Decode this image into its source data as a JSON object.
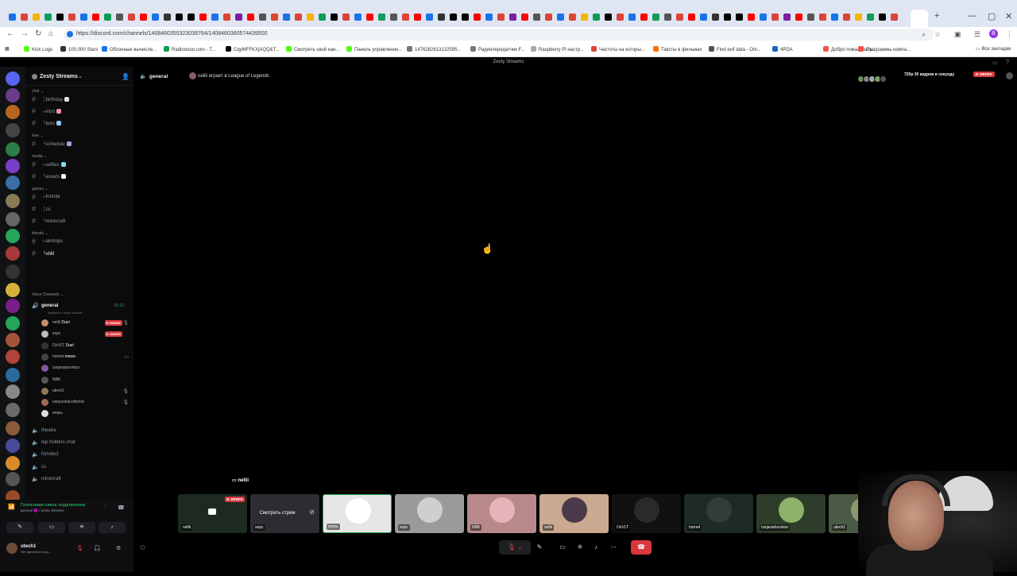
{
  "browser": {
    "url": "https://discord.com/channels/1408460355323039764/1408460360574439500",
    "bookmarks": [
      {
        "label": "Kick Logo",
        "color": "#53fc18"
      },
      {
        "label": "100,000 Stars",
        "color": "#333333"
      },
      {
        "label": "Облачные вычисле...",
        "color": "#1a73e8"
      },
      {
        "label": "Radiooooo.com - T...",
        "color": "#0f9d58"
      },
      {
        "label": "CqyMFFKXjAQQ&T...",
        "color": "#000000"
      },
      {
        "label": "Смотреть свой кан...",
        "color": "#53fc18"
      },
      {
        "label": "Панель управления...",
        "color": "#53fc18"
      },
      {
        "label": "1476282613122595...",
        "color": "#777777"
      },
      {
        "label": "Радиопередатчик F...",
        "color": "#777777"
      },
      {
        "label": "Raspberry Pi настр...",
        "color": "#aaaaaa"
      },
      {
        "label": "Частоты на которы...",
        "color": "#db4437"
      },
      {
        "label": "Таксты в фильмах",
        "color": "#ff6d00"
      },
      {
        "label": "Find exif data - Onl...",
        "color": "#555555"
      },
      {
        "label": "4PDA",
        "color": "#1565c0"
      },
      {
        "label": "Добро пожаловать...",
        "color": "#ef5350"
      },
      {
        "label": "Программы компа...",
        "color": "#ef5350"
      }
    ],
    "all_bookmarks": "Все закладки",
    "profile_initial": "B"
  },
  "app": {
    "window_title": "Zesty Streams"
  },
  "sidebar": {
    "server_name": "Zesty Streams",
    "categories": [
      {
        "name": "chat",
        "channels": [
          {
            "name": "╎birthday",
            "emoji": "#e0e0e0"
          },
          {
            "name": "⌐intro",
            "emoji": "#f48fb1"
          },
          {
            "name": "╰bots",
            "emoji": "#90caf9"
          }
        ]
      },
      {
        "name": "love",
        "channels": [
          {
            "name": "╰schedule",
            "emoji": "#b39ddb"
          }
        ]
      },
      {
        "name": "media",
        "channels": [
          {
            "name": "⌐selfies",
            "emoji": "#80deea"
          },
          {
            "name": "╰assets",
            "emoji": "#ffffff"
          }
        ]
      },
      {
        "name": "games",
        "channels": [
          {
            "name": "⌐fortnite",
            "emoji": ""
          },
          {
            "name": "╎cs",
            "emoji": ""
          },
          {
            "name": "╰minecraft",
            "emoji": ""
          }
        ]
      },
      {
        "name": "friends",
        "channels": [
          {
            "name": "⌐airdrops",
            "emoji": ""
          },
          {
            "name": "╰shill",
            "emoji": ""
          }
        ]
      }
    ],
    "voice_category": "Voice Channels",
    "active_voice": {
      "name": "general",
      "timer": "51:22",
      "status": "Выбрать статус канала"
    },
    "voice_users": [
      {
        "name": "nellii",
        "tag": "Duel",
        "live": "В ЭФИРЕ",
        "color": "#c88e6e"
      },
      {
        "name": "sopc",
        "tag": "",
        "live": "В ЭФИРЕ",
        "color": "#bbbbbb"
      },
      {
        "name": "OxVLT",
        "tag": "Duel",
        "live": "",
        "color": "#333333"
      },
      {
        "name": "hornet",
        "tag": "meow",
        "live": "",
        "color": "#444444"
      },
      {
        "name": "Izejaradurvistur",
        "tag": "",
        "live": "",
        "color": "#7a5c9a"
      },
      {
        "name": "NBK",
        "tag": "",
        "live": "",
        "color": "#555555"
      },
      {
        "name": "utech1",
        "tag": "",
        "live": "",
        "color": "#8a7a55"
      },
      {
        "name": "vanyushacollector",
        "tag": "",
        "live": "",
        "color": "#9a6a5a"
      },
      {
        "name": "игорь",
        "tag": "",
        "live": "",
        "color": "#dddddd"
      }
    ],
    "other_voice": [
      "theatre",
      "top holders chat",
      "fortnite2",
      "cs",
      "minecraft"
    ],
    "voice_panel": {
      "status": "Голосовая связь подключена",
      "sub": "general 😈 / Zesty Streams"
    },
    "user": {
      "name": "utech1",
      "status": "Нет времени на ра..."
    }
  },
  "main": {
    "channel": "general",
    "activity": "nellii играет в League of Legends",
    "quality": "720p 30 кадров в секунду",
    "live_badge": "В ЭФИРЕ",
    "stream_owner": "nellii",
    "watch_label": "Смотреть стрим",
    "tiles": [
      {
        "name": "nellii",
        "live": "В ЭФИРЕ",
        "bg": "#1d2a1f",
        "circle": ""
      },
      {
        "name": "sopc",
        "live": "",
        "bg": "#2b2d31",
        "circle": ""
      },
      {
        "name": "игорь",
        "live": "",
        "bg": "#e6e6e6",
        "circle": "#ffffff"
      },
      {
        "name": "sopc",
        "live": "",
        "bg": "#9a9a9a",
        "circle": "#cfcfcf"
      },
      {
        "name": "NBK",
        "live": "",
        "bg": "#b8898a",
        "circle": "#e8b3b8"
      },
      {
        "name": "nellii",
        "live": "",
        "bg": "#c9a98f",
        "circle": "#4a3a4a"
      },
      {
        "name": "OxVLT",
        "live": "",
        "bg": "#111111",
        "circle": "#2a2a2a"
      },
      {
        "name": "hornet",
        "live": "",
        "bg": "#1e2a26",
        "circle": "#333d38"
      },
      {
        "name": "Izejaradurvistur",
        "live": "",
        "bg": "#2e3d2a",
        "circle": "#8db36a"
      },
      {
        "name": "utech1",
        "live": "",
        "bg": "#4a5a44",
        "circle": "#8a9a70"
      }
    ]
  }
}
